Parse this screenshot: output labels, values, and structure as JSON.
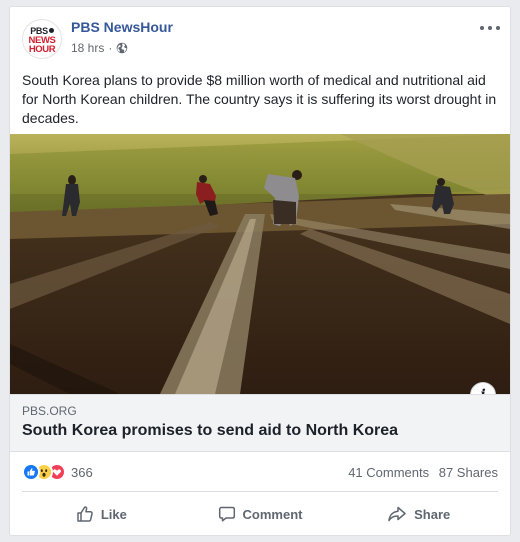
{
  "post": {
    "page_name": "PBS NewsHour",
    "avatar_text": {
      "line1": "PBS",
      "line2": "NEWS",
      "line3": "HOUR"
    },
    "timestamp": "18 hrs",
    "separator": "·",
    "audience_icon": "globe-icon",
    "more_icon": "more-horizontal-icon",
    "text": "South Korea plans to provide $8 million worth of medical and nutritional aid for North Korean children. The country says it is suffering its worst drought in decades."
  },
  "link": {
    "domain": "PBS.ORG",
    "title": "South Korea promises to send aid to North Korea",
    "info_icon_glyph": "i"
  },
  "stats": {
    "reactions": [
      "like-reaction-icon",
      "wow-reaction-icon",
      "love-reaction-icon"
    ],
    "reaction_count": "366",
    "comments": "41 Comments",
    "shares": "87 Shares"
  },
  "actions": {
    "like": "Like",
    "comment": "Comment",
    "share": "Share"
  },
  "colors": {
    "page_name": "#365899",
    "secondary_text": "#606770",
    "like_blue": "#1877f2",
    "love_red": "#f33e58",
    "wow_yellow": "#fcd149",
    "brand_red": "#d2202f"
  }
}
